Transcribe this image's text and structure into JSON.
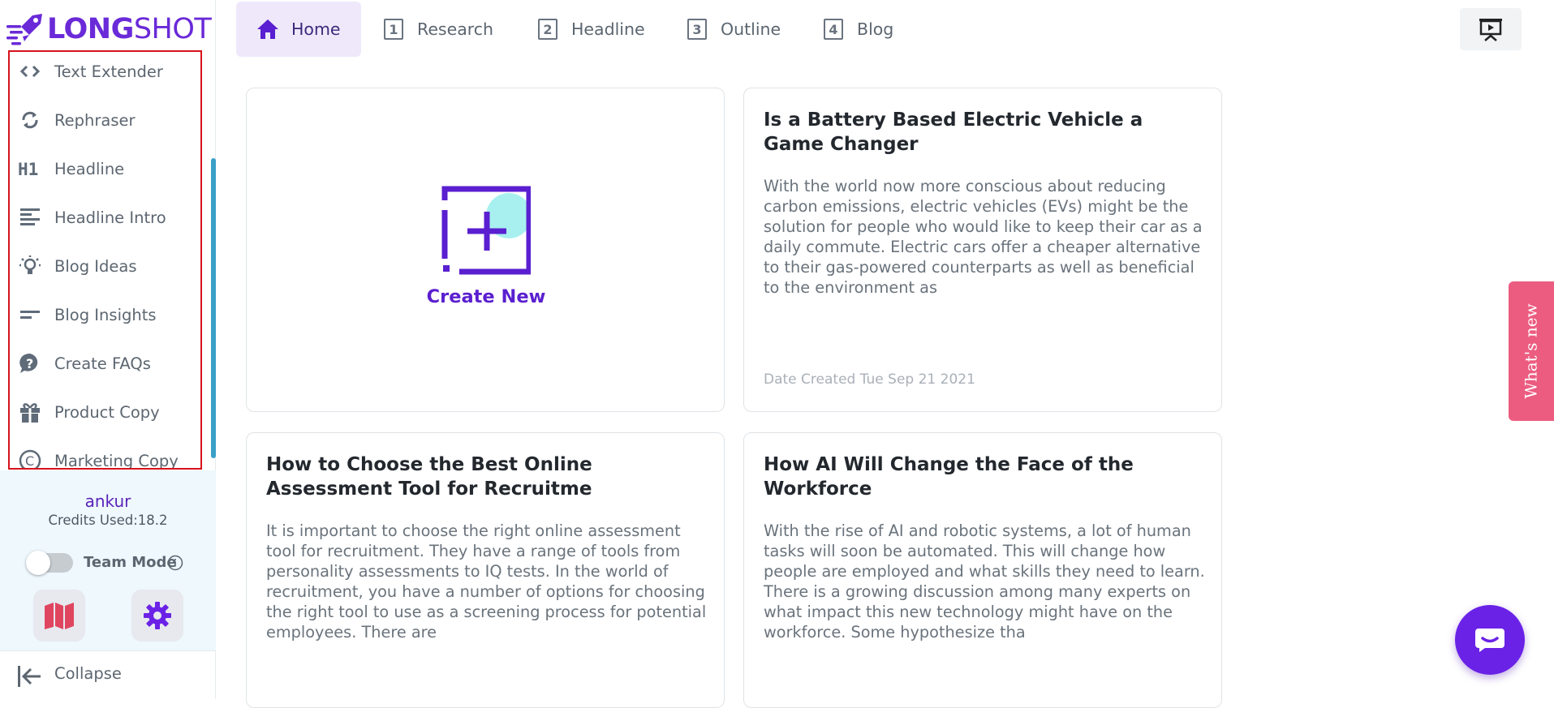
{
  "app": {
    "logo_main": "LONG",
    "logo_sub": "SHOT",
    "brand_color": "#6a2ad8"
  },
  "sidebar": {
    "items": [
      {
        "label": "Text Extender",
        "icon": "code-icon"
      },
      {
        "label": "Rephraser",
        "icon": "sync-icon"
      },
      {
        "label": "Headline",
        "icon": "h1-icon"
      },
      {
        "label": "Headline Intro",
        "icon": "subject-icon"
      },
      {
        "label": "Blog Ideas",
        "icon": "lightbulb-icon"
      },
      {
        "label": "Blog Insights",
        "icon": "short-text-icon"
      },
      {
        "label": "Create FAQs",
        "icon": "help-bubble-icon"
      },
      {
        "label": "Product Copy",
        "icon": "gift-icon"
      },
      {
        "label": "Marketing Copy",
        "icon": "copyright-icon"
      }
    ],
    "highlight_color": "#d6131c"
  },
  "profile": {
    "username": "ankur",
    "credits": "Credits Used:18.2",
    "team_mode_label": "Team Mode",
    "team_mode_on": false
  },
  "collapse": {
    "label": "Collapse"
  },
  "nav": {
    "tabs": [
      {
        "label": "Home",
        "icon": "home-icon",
        "active": true
      },
      {
        "number": "1",
        "label": "Research"
      },
      {
        "number": "2",
        "label": "Headline"
      },
      {
        "number": "3",
        "label": "Outline"
      },
      {
        "number": "4",
        "label": "Blog"
      }
    ]
  },
  "create_card": {
    "label": "Create New"
  },
  "cards": [
    {
      "title": "Is a Battery Based Electric Vehicle a Game Changer",
      "excerpt": "With the world now more conscious about reducing carbon emissions, electric vehicles (EVs) might be the solution for people who would like to keep their car as a daily commute. Electric cars offer a cheaper alternative to their gas-powered counterparts as well as beneficial to the environment as",
      "date": "Date Created Tue Sep 21 2021"
    },
    {
      "title": "How to Choose the Best Online Assessment Tool for Recruitme",
      "excerpt": "It is important to choose the right online assessment tool for recruitment. They have a range of tools from personality assessments to IQ tests. In the world of recruitment, you have a number of options for choosing the right tool to use as a screening process for potential employees. There are"
    },
    {
      "title": "How AI Will Change the Face of the Workforce",
      "excerpt": "With the rise of AI and robotic systems, a lot of human tasks will soon be automated. This will change how people are employed and what skills they need to learn. There is a growing discussion among many experts on what impact this new technology might have on the workforce. Some hypothesize tha"
    }
  ],
  "whats_new": {
    "label": "What's new",
    "color": "#ec5c80"
  },
  "chat": {
    "icon": "chat-bubble-icon",
    "color": "#6a22e6"
  }
}
